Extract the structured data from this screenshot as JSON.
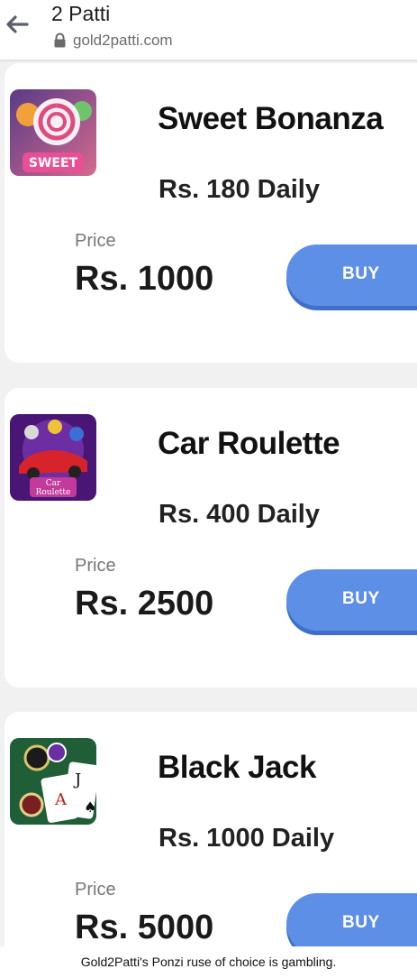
{
  "header": {
    "title": "2 Patti",
    "url": "gold2patti.com"
  },
  "products": [
    {
      "name": "Sweet Bonanza",
      "daily": "Rs. 180 Daily",
      "price_label": "Price",
      "price": "Rs. 1000",
      "buy_label": "BUY",
      "thumb_text": "SWEET",
      "icon": "sweet-bonanza-game-icon"
    },
    {
      "name": "Car Roulette",
      "daily": "Rs. 400 Daily",
      "price_label": "Price",
      "price": "Rs. 2500",
      "buy_label": "BUY",
      "thumb_text": "Car Roulette",
      "icon": "car-roulette-game-icon"
    },
    {
      "name": "Black Jack",
      "daily": "Rs. 1000 Daily",
      "price_label": "Price",
      "price": "Rs. 5000",
      "buy_label": "BUY",
      "thumb_text": "",
      "icon": "black-jack-game-icon"
    }
  ],
  "caption": "Gold2Patti's Ponzi ruse of choice is gambling.",
  "colors": {
    "buy_button": "#5d8fe6",
    "card_background": "#ffffff",
    "page_background": "#f1f1f1"
  }
}
